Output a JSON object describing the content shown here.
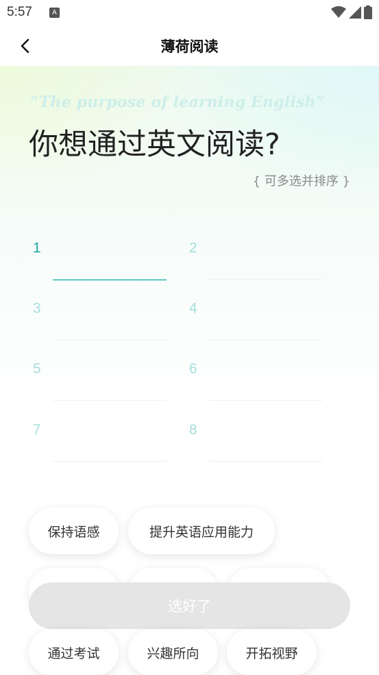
{
  "status_bar": {
    "time": "5:57",
    "notification_icon": "A"
  },
  "app_bar": {
    "title": "薄荷阅读"
  },
  "hero": {
    "quote": "“The purpose of learning English”",
    "question": "你想通过英文阅读?",
    "hint": "{ 可多选并排序 }"
  },
  "slots": [
    "1",
    "2",
    "3",
    "4",
    "5",
    "6",
    "7",
    "8"
  ],
  "options": {
    "row1": [
      "保持语感",
      "提升英语应用能力"
    ],
    "row3": [
      "通过考试",
      "兴趣所向",
      "开拓视野"
    ]
  },
  "confirm_button": "选好了",
  "colors": {
    "accent": "#1aa7a4",
    "slot_inactive": "#a5dedd",
    "button_disabled": "#e5e5e5"
  }
}
